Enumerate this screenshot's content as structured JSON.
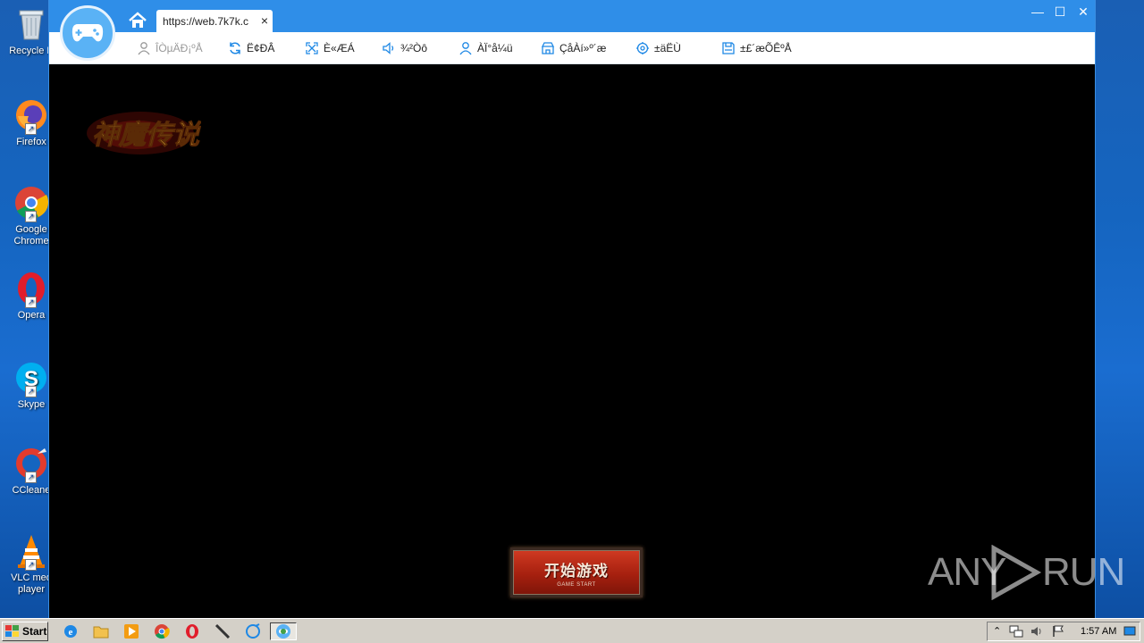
{
  "desktop": {
    "icons": [
      {
        "label": "Recycle Bin",
        "shown": "Recycle B"
      },
      {
        "label": "Firefox"
      },
      {
        "label": "Google Chrome",
        "line1": "Google",
        "line2": "Chrome"
      },
      {
        "label": "Opera"
      },
      {
        "label": "Skype"
      },
      {
        "label": "CCleaner",
        "shown": "CCleane"
      },
      {
        "label": "VLC media player",
        "line1": "VLC med",
        "line2": "player"
      }
    ]
  },
  "browser": {
    "tab_url": "https://web.7k7k.c",
    "tab_close": "×",
    "window_controls": {
      "minimize": "—",
      "maximize": "☐",
      "close": "✕"
    },
    "toolbar": [
      {
        "label": "ÎÒµÄÐ¡ºÅ",
        "icon": "user-icon",
        "enabled": false
      },
      {
        "label": "Ë¢ÐÂ",
        "icon": "refresh-icon",
        "enabled": true
      },
      {
        "label": "È«ÆÁ",
        "icon": "fullscreen-icon",
        "enabled": true
      },
      {
        "label": "¾²Òô",
        "icon": "speaker-icon",
        "enabled": true
      },
      {
        "label": "ÀÏ°å¼ü",
        "icon": "boss-key-icon",
        "enabled": true
      },
      {
        "label": "ÇåÀí»º´æ",
        "icon": "clean-cache-icon",
        "enabled": true
      },
      {
        "label": "±äËÙ",
        "icon": "speed-icon",
        "enabled": true
      },
      {
        "label": "±£´æÕÊºÅ",
        "icon": "save-icon",
        "enabled": true
      }
    ]
  },
  "game": {
    "logo_text": "神魔传说",
    "start_button": {
      "cn": "开始游戏",
      "en": "GAME START"
    }
  },
  "watermark": {
    "left": "ANY",
    "right": "RUN"
  },
  "taskbar": {
    "start_label": "Start",
    "apps": [
      "internet-explorer-icon",
      "file-explorer-icon",
      "media-player-icon",
      "chrome-icon",
      "opera-icon",
      "pen-tool-icon",
      "unknown-app-icon",
      "gamepad-app-icon"
    ],
    "clock": "1:57 AM"
  },
  "colors": {
    "titlebar": "#2f8ee8",
    "game_bg": "#000000",
    "start_red": "#b12613"
  }
}
